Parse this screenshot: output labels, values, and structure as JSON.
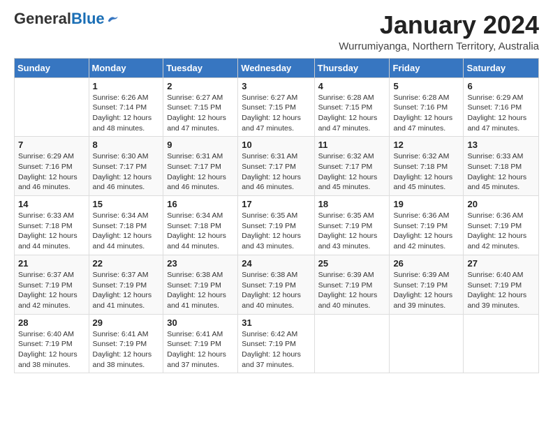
{
  "logo": {
    "general": "General",
    "blue": "Blue"
  },
  "header": {
    "month_year": "January 2024",
    "location": "Wurrumiyanga, Northern Territory, Australia"
  },
  "weekdays": [
    "Sunday",
    "Monday",
    "Tuesday",
    "Wednesday",
    "Thursday",
    "Friday",
    "Saturday"
  ],
  "weeks": [
    [
      {
        "day": "",
        "sunrise": "",
        "sunset": "",
        "daylight": ""
      },
      {
        "day": "1",
        "sunrise": "Sunrise: 6:26 AM",
        "sunset": "Sunset: 7:14 PM",
        "daylight": "Daylight: 12 hours and 48 minutes."
      },
      {
        "day": "2",
        "sunrise": "Sunrise: 6:27 AM",
        "sunset": "Sunset: 7:15 PM",
        "daylight": "Daylight: 12 hours and 47 minutes."
      },
      {
        "day": "3",
        "sunrise": "Sunrise: 6:27 AM",
        "sunset": "Sunset: 7:15 PM",
        "daylight": "Daylight: 12 hours and 47 minutes."
      },
      {
        "day": "4",
        "sunrise": "Sunrise: 6:28 AM",
        "sunset": "Sunset: 7:15 PM",
        "daylight": "Daylight: 12 hours and 47 minutes."
      },
      {
        "day": "5",
        "sunrise": "Sunrise: 6:28 AM",
        "sunset": "Sunset: 7:16 PM",
        "daylight": "Daylight: 12 hours and 47 minutes."
      },
      {
        "day": "6",
        "sunrise": "Sunrise: 6:29 AM",
        "sunset": "Sunset: 7:16 PM",
        "daylight": "Daylight: 12 hours and 47 minutes."
      }
    ],
    [
      {
        "day": "7",
        "sunrise": "Sunrise: 6:29 AM",
        "sunset": "Sunset: 7:16 PM",
        "daylight": "Daylight: 12 hours and 46 minutes."
      },
      {
        "day": "8",
        "sunrise": "Sunrise: 6:30 AM",
        "sunset": "Sunset: 7:17 PM",
        "daylight": "Daylight: 12 hours and 46 minutes."
      },
      {
        "day": "9",
        "sunrise": "Sunrise: 6:31 AM",
        "sunset": "Sunset: 7:17 PM",
        "daylight": "Daylight: 12 hours and 46 minutes."
      },
      {
        "day": "10",
        "sunrise": "Sunrise: 6:31 AM",
        "sunset": "Sunset: 7:17 PM",
        "daylight": "Daylight: 12 hours and 46 minutes."
      },
      {
        "day": "11",
        "sunrise": "Sunrise: 6:32 AM",
        "sunset": "Sunset: 7:17 PM",
        "daylight": "Daylight: 12 hours and 45 minutes."
      },
      {
        "day": "12",
        "sunrise": "Sunrise: 6:32 AM",
        "sunset": "Sunset: 7:18 PM",
        "daylight": "Daylight: 12 hours and 45 minutes."
      },
      {
        "day": "13",
        "sunrise": "Sunrise: 6:33 AM",
        "sunset": "Sunset: 7:18 PM",
        "daylight": "Daylight: 12 hours and 45 minutes."
      }
    ],
    [
      {
        "day": "14",
        "sunrise": "Sunrise: 6:33 AM",
        "sunset": "Sunset: 7:18 PM",
        "daylight": "Daylight: 12 hours and 44 minutes."
      },
      {
        "day": "15",
        "sunrise": "Sunrise: 6:34 AM",
        "sunset": "Sunset: 7:18 PM",
        "daylight": "Daylight: 12 hours and 44 minutes."
      },
      {
        "day": "16",
        "sunrise": "Sunrise: 6:34 AM",
        "sunset": "Sunset: 7:18 PM",
        "daylight": "Daylight: 12 hours and 44 minutes."
      },
      {
        "day": "17",
        "sunrise": "Sunrise: 6:35 AM",
        "sunset": "Sunset: 7:19 PM",
        "daylight": "Daylight: 12 hours and 43 minutes."
      },
      {
        "day": "18",
        "sunrise": "Sunrise: 6:35 AM",
        "sunset": "Sunset: 7:19 PM",
        "daylight": "Daylight: 12 hours and 43 minutes."
      },
      {
        "day": "19",
        "sunrise": "Sunrise: 6:36 AM",
        "sunset": "Sunset: 7:19 PM",
        "daylight": "Daylight: 12 hours and 42 minutes."
      },
      {
        "day": "20",
        "sunrise": "Sunrise: 6:36 AM",
        "sunset": "Sunset: 7:19 PM",
        "daylight": "Daylight: 12 hours and 42 minutes."
      }
    ],
    [
      {
        "day": "21",
        "sunrise": "Sunrise: 6:37 AM",
        "sunset": "Sunset: 7:19 PM",
        "daylight": "Daylight: 12 hours and 42 minutes."
      },
      {
        "day": "22",
        "sunrise": "Sunrise: 6:37 AM",
        "sunset": "Sunset: 7:19 PM",
        "daylight": "Daylight: 12 hours and 41 minutes."
      },
      {
        "day": "23",
        "sunrise": "Sunrise: 6:38 AM",
        "sunset": "Sunset: 7:19 PM",
        "daylight": "Daylight: 12 hours and 41 minutes."
      },
      {
        "day": "24",
        "sunrise": "Sunrise: 6:38 AM",
        "sunset": "Sunset: 7:19 PM",
        "daylight": "Daylight: 12 hours and 40 minutes."
      },
      {
        "day": "25",
        "sunrise": "Sunrise: 6:39 AM",
        "sunset": "Sunset: 7:19 PM",
        "daylight": "Daylight: 12 hours and 40 minutes."
      },
      {
        "day": "26",
        "sunrise": "Sunrise: 6:39 AM",
        "sunset": "Sunset: 7:19 PM",
        "daylight": "Daylight: 12 hours and 39 minutes."
      },
      {
        "day": "27",
        "sunrise": "Sunrise: 6:40 AM",
        "sunset": "Sunset: 7:19 PM",
        "daylight": "Daylight: 12 hours and 39 minutes."
      }
    ],
    [
      {
        "day": "28",
        "sunrise": "Sunrise: 6:40 AM",
        "sunset": "Sunset: 7:19 PM",
        "daylight": "Daylight: 12 hours and 38 minutes."
      },
      {
        "day": "29",
        "sunrise": "Sunrise: 6:41 AM",
        "sunset": "Sunset: 7:19 PM",
        "daylight": "Daylight: 12 hours and 38 minutes."
      },
      {
        "day": "30",
        "sunrise": "Sunrise: 6:41 AM",
        "sunset": "Sunset: 7:19 PM",
        "daylight": "Daylight: 12 hours and 37 minutes."
      },
      {
        "day": "31",
        "sunrise": "Sunrise: 6:42 AM",
        "sunset": "Sunset: 7:19 PM",
        "daylight": "Daylight: 12 hours and 37 minutes."
      },
      {
        "day": "",
        "sunrise": "",
        "sunset": "",
        "daylight": ""
      },
      {
        "day": "",
        "sunrise": "",
        "sunset": "",
        "daylight": ""
      },
      {
        "day": "",
        "sunrise": "",
        "sunset": "",
        "daylight": ""
      }
    ]
  ]
}
